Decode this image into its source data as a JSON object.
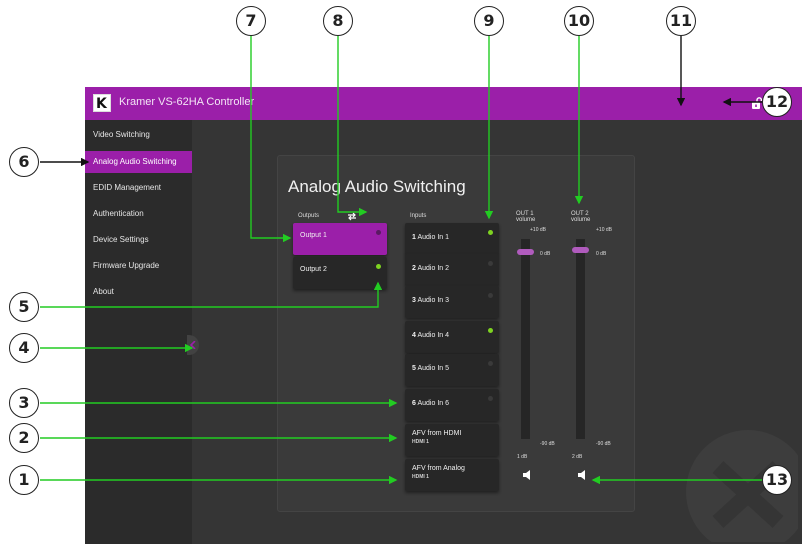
{
  "app": {
    "title": "Kramer VS-62HA Controller",
    "logo_letter": "K"
  },
  "sidebar": {
    "items": [
      {
        "label": "Video Switching",
        "active": false
      },
      {
        "label": "Analog Audio Switching",
        "active": true
      },
      {
        "label": "EDID Management",
        "active": false
      },
      {
        "label": "Authentication",
        "active": false
      },
      {
        "label": "Device Settings",
        "active": false
      },
      {
        "label": "Firmware Upgrade",
        "active": false
      },
      {
        "label": "About",
        "active": false
      }
    ]
  },
  "page": {
    "title": "Analog Audio Switching",
    "outputs_label": "Outputs",
    "inputs_label": "Inputs"
  },
  "outputs": [
    {
      "label": "Output 1",
      "selected": true,
      "led": "off"
    },
    {
      "label": "Output 2",
      "selected": false,
      "led": "on"
    }
  ],
  "inputs": [
    {
      "num": "1",
      "label": "Audio In 1",
      "led": "on"
    },
    {
      "num": "2",
      "label": "Audio In 2",
      "led": "off"
    },
    {
      "num": "3",
      "label": "Audio In 3",
      "led": "off"
    },
    {
      "num": "4",
      "label": "Audio In 4",
      "led": "on"
    },
    {
      "num": "5",
      "label": "Audio In 5",
      "led": "off"
    },
    {
      "num": "6",
      "label": "Audio In 6",
      "led": "off"
    }
  ],
  "afv": [
    {
      "label": "AFV from HDMI",
      "sub": "HDMI 1"
    },
    {
      "label": "AFV from Analog",
      "sub": "HDMI 1"
    }
  ],
  "volumes": [
    {
      "label_line1": "OUT 1",
      "label_line2": "volume",
      "max": "+10 dB",
      "min": "-90 dB",
      "current_label": "0 dB",
      "readout": "1 dB",
      "level": 0.9
    },
    {
      "label_line1": "OUT 2",
      "label_line2": "volume",
      "max": "+10 dB",
      "min": "-90 dB",
      "current_label": "0 dB",
      "readout": "2 dB",
      "level": 0.9
    }
  ],
  "callouts": [
    "1",
    "2",
    "3",
    "4",
    "5",
    "6",
    "7",
    "8",
    "9",
    "10",
    "11",
    "12",
    "13"
  ],
  "colors": {
    "accent": "#9b1fa9",
    "led_on": "#7ed321",
    "arrow": "#22cc22",
    "bg": "#353535",
    "sidebar": "#2b2b2b"
  },
  "icons": {
    "lock": "lock-open-icon",
    "fullscreen": "fullscreen-icon",
    "swap": "swap-arrows-icon",
    "speaker": "speaker-icon",
    "collapse": "chevron-left-icon"
  }
}
